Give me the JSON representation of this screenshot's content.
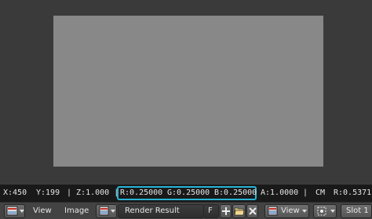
{
  "viewer": {
    "image_color": "#888888",
    "background_color": "#3a3a3a"
  },
  "statusbar": {
    "x": "X:450",
    "y": "Y:199",
    "z": "| Z:1.000 |",
    "r": "R:0.25000",
    "g": "G:0.25000",
    "b": "B:0.25000",
    "a": "A:1.0000",
    "sep": "|",
    "cm": "CM",
    "cm_r": "R:0.5371",
    "highlight_color": "#29b3d6"
  },
  "header": {
    "editor_type_icon": "image-editor-icon",
    "menu_view": "View",
    "menu_image": "Image",
    "image_browse_icon": "image-browse-icon",
    "image_name": "Render Result",
    "fake_user": "F",
    "new_icon": "plus-icon",
    "open_icon": "folder-icon",
    "unlink_icon": "close-icon",
    "mode_icon": "view-mode-icon",
    "mode_value": "View",
    "pivot_icon": "pivot-icon",
    "slot_value": "Slot 1"
  }
}
